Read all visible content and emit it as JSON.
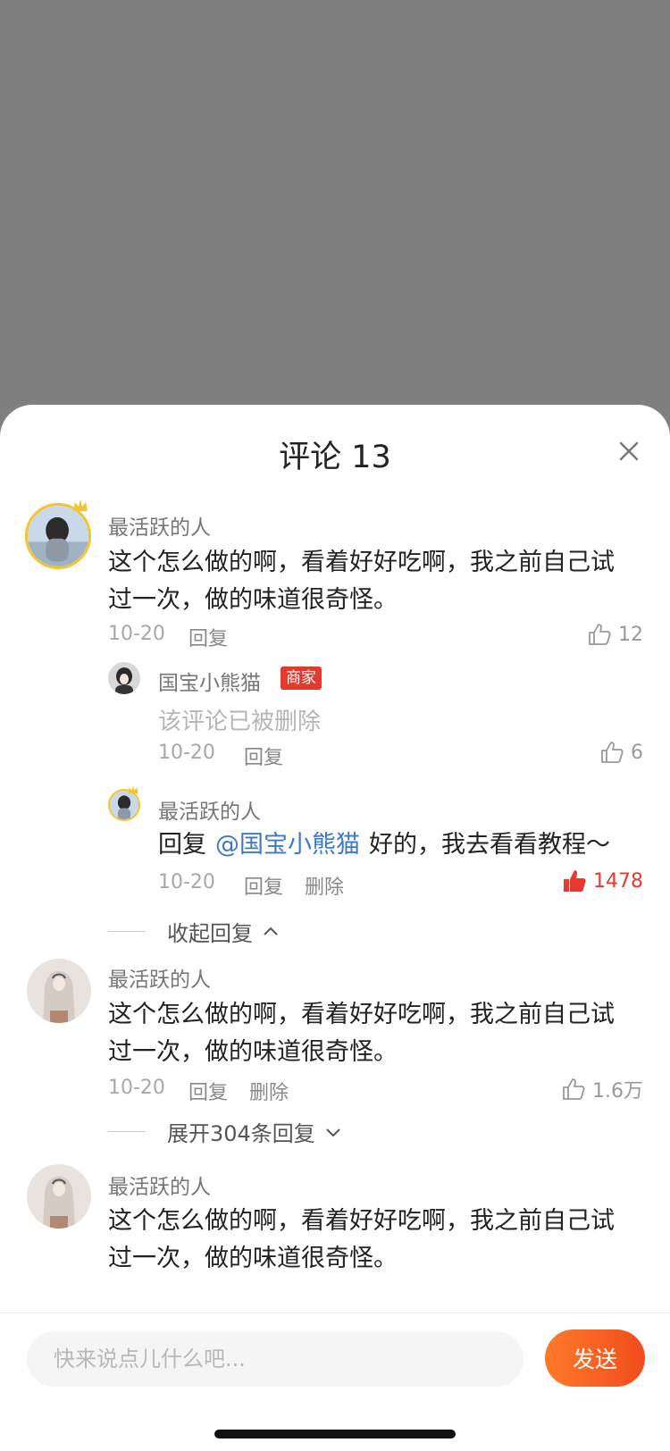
{
  "header": {
    "title": "评论 13"
  },
  "comments": [
    {
      "name": "最活跃的人",
      "content_line1": "这个怎么做的啊，看着好好吃啊，我之前自己试",
      "content_line2": "过一次，做的味道很奇怪。",
      "date": "10-20",
      "reply_label": "回复",
      "likes": "12",
      "replies": [
        {
          "name": "国宝小熊猫",
          "badge": "商家",
          "content": "该评论已被删除",
          "date": "10-20",
          "reply_label": "回复",
          "likes": "6"
        },
        {
          "name": "最活跃的人",
          "reply_prefix": "回复",
          "mention": "@国宝小熊猫",
          "content": "好的，我去看看教程～",
          "date": "10-20",
          "reply_label": "回复",
          "delete_label": "删除",
          "likes": "1478"
        }
      ],
      "collapse_label": "收起回复"
    },
    {
      "name": "最活跃的人",
      "content_line1": "这个怎么做的啊，看着好好吃啊，我之前自己试",
      "content_line2": "过一次，做的味道很奇怪。",
      "date": "10-20",
      "reply_label": "回复",
      "delete_label": "删除",
      "likes": "1.6万",
      "expand_label": "展开304条回复"
    },
    {
      "name": "最活跃的人",
      "content_line1": "这个怎么做的啊，看着好好吃啊，我之前自己试",
      "content_line2": "过一次，做的味道很奇怪。"
    }
  ],
  "footer": {
    "input_placeholder": "快来说点儿什么吧...",
    "send_label": "发送"
  },
  "colors": {
    "accent": "#f04c1c",
    "liked": "#e6392f",
    "mention": "#3a79c9",
    "badge": "#e4392b"
  }
}
